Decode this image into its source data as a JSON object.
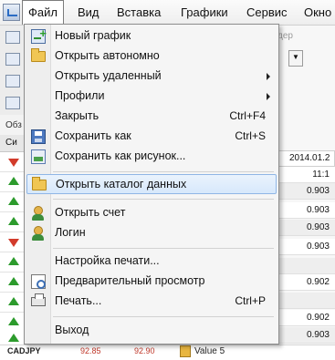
{
  "menubar": {
    "items": [
      {
        "label": "Файл"
      },
      {
        "label": "Вид"
      },
      {
        "label": "Вставка"
      },
      {
        "label": "Графики"
      },
      {
        "label": "Сервис"
      },
      {
        "label": "Окно"
      }
    ]
  },
  "file_menu": {
    "items": [
      {
        "label": "Новый график",
        "icon": "new-chart-icon"
      },
      {
        "label": "Открыть автономно",
        "icon": "folder-open-icon"
      },
      {
        "label": "Открыть удаленный",
        "submenu": true
      },
      {
        "label": "Профили",
        "submenu": true
      },
      {
        "label": "Закрыть",
        "shortcut": "Ctrl+F4"
      },
      {
        "label": "Сохранить как",
        "shortcut": "Ctrl+S",
        "icon": "save-icon"
      },
      {
        "label": "Сохранить как рисунок...",
        "icon": "save-picture-icon"
      },
      {
        "label": "Открыть каталог данных",
        "icon": "folder-icon",
        "highlighted": true
      },
      {
        "label": "Открыть счет",
        "icon": "open-account-icon"
      },
      {
        "label": "Логин",
        "icon": "login-icon"
      },
      {
        "label": "Настройка печати..."
      },
      {
        "label": "Предварительный просмотр",
        "icon": "print-preview-icon"
      },
      {
        "label": "Печать...",
        "shortcut": "Ctrl+P",
        "icon": "printer-icon"
      },
      {
        "label": "Выход"
      }
    ]
  },
  "background": {
    "toolbar_hint": "дер",
    "market_watch_label": "Обз",
    "market_watch_header": "Си",
    "right_date": "2014.01.2",
    "right_values": [
      "11:1",
      "0.903",
      "0.903",
      "0.903",
      "0.903",
      "",
      "0.902",
      "",
      "0.902",
      "0.903"
    ],
    "bottom_symbol": "CADJPY",
    "bottom_bid": "92.85",
    "bottom_ask": "92.90",
    "bottom_label": "Value 5"
  },
  "colors": {
    "highlight": "#d7e8fb",
    "highlight_border": "#8fb6e6",
    "up_arrow": "#2c9b2c",
    "down_arrow": "#d23b2b"
  }
}
